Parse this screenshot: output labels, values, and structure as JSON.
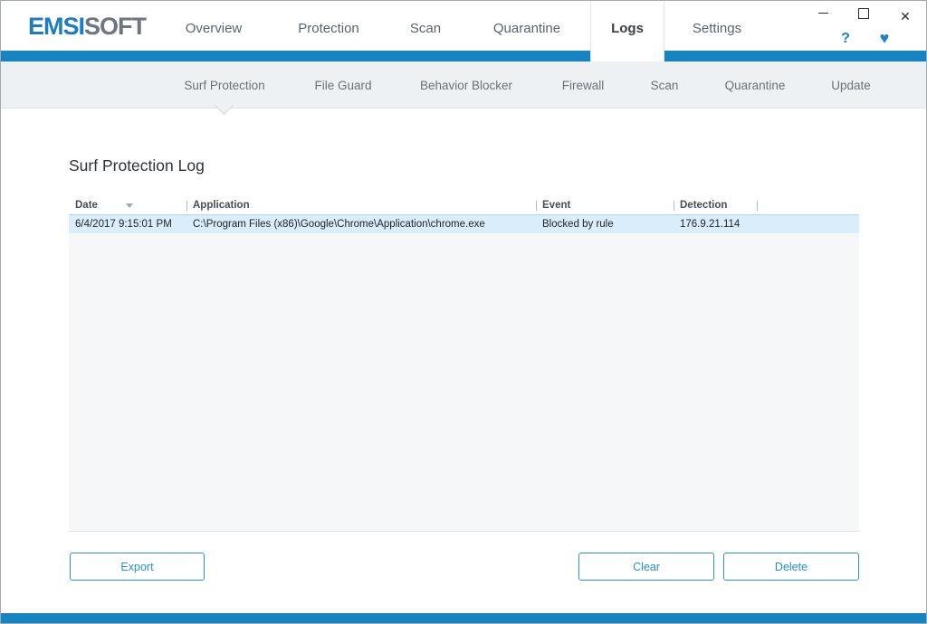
{
  "colors": {
    "accent": "#1584c1",
    "logo-blue": "#1e7dbd",
    "logo-gray": "#6d767e",
    "icon-blue": "#1e83c4",
    "button-blue": "#2590d0",
    "selected-row-bg": "#d9edfa"
  },
  "logo": {
    "emsi": "EMSI",
    "soft": "SOFT"
  },
  "window_controls": {
    "close": "✕"
  },
  "icons": {
    "help": "?",
    "heart": "♥"
  },
  "topnav": {
    "items": [
      {
        "label": "Overview",
        "active": false
      },
      {
        "label": "Protection",
        "active": false
      },
      {
        "label": "Scan",
        "active": false
      },
      {
        "label": "Quarantine",
        "active": false
      },
      {
        "label": "Logs",
        "active": true
      },
      {
        "label": "Settings",
        "active": false
      }
    ]
  },
  "subnav": {
    "active": "Surf Protection",
    "items": [
      "Surf Protection",
      "File Guard",
      "Behavior Blocker",
      "Firewall",
      "Scan",
      "Quarantine",
      "Update"
    ]
  },
  "page": {
    "title": "Surf Protection Log"
  },
  "table": {
    "columns": [
      "Date",
      "Application",
      "Event",
      "Detection"
    ],
    "sorted_column": "Date",
    "sort_direction": "descending",
    "rows": [
      {
        "date": "6/4/2017 9:15:01 PM",
        "application": "C:\\Program Files (x86)\\Google\\Chrome\\Application\\chrome.exe",
        "event": "Blocked by rule",
        "detection": "176.9.21.114"
      }
    ]
  },
  "buttons": {
    "export": "Export",
    "clear": "Clear",
    "delete": "Delete"
  }
}
